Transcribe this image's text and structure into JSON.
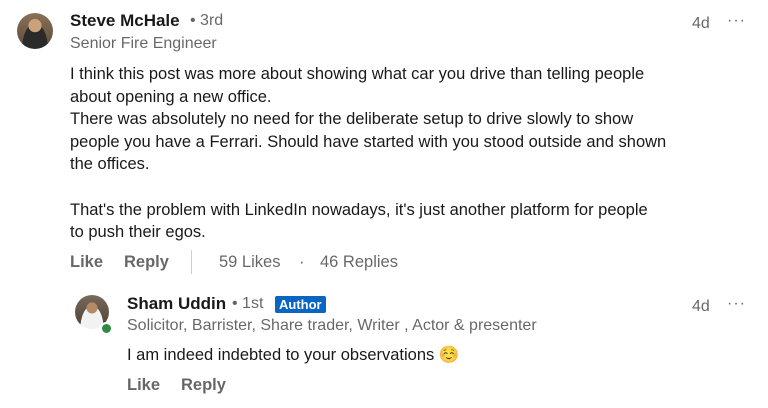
{
  "comment": {
    "author_name": "Steve McHale",
    "degree": "• 3rd",
    "headline": "Senior Fire Engineer",
    "time": "4d",
    "more": "···",
    "lines": [
      "I think this post was more about showing what car you drive than telling people",
      "about opening a new office.",
      "There was absolutely no need for the deliberate setup to drive slowly to show",
      "people you have a Ferrari. Should have started with you stood outside and shown",
      "the offices.",
      "",
      "That's the problem with LinkedIn nowadays, it's just another platform for people",
      "to push their egos."
    ],
    "like_label": "Like",
    "reply_label": "Reply",
    "likes_count": "59 Likes",
    "dot_separator": "·",
    "replies_count": "46 Replies"
  },
  "reply": {
    "author_name": "Sham Uddin",
    "degree": "• 1st",
    "badge": "Author",
    "headline": "Solicitor, Barrister, Share trader, Writer , Actor & presenter",
    "time": "4d",
    "more": "···",
    "text": "I am indeed indebted to your observations ☺️",
    "like_label": "Like",
    "reply_label": "Reply"
  },
  "colors": {
    "badge": "#0a66c2",
    "presence": "#2e8b3e"
  }
}
